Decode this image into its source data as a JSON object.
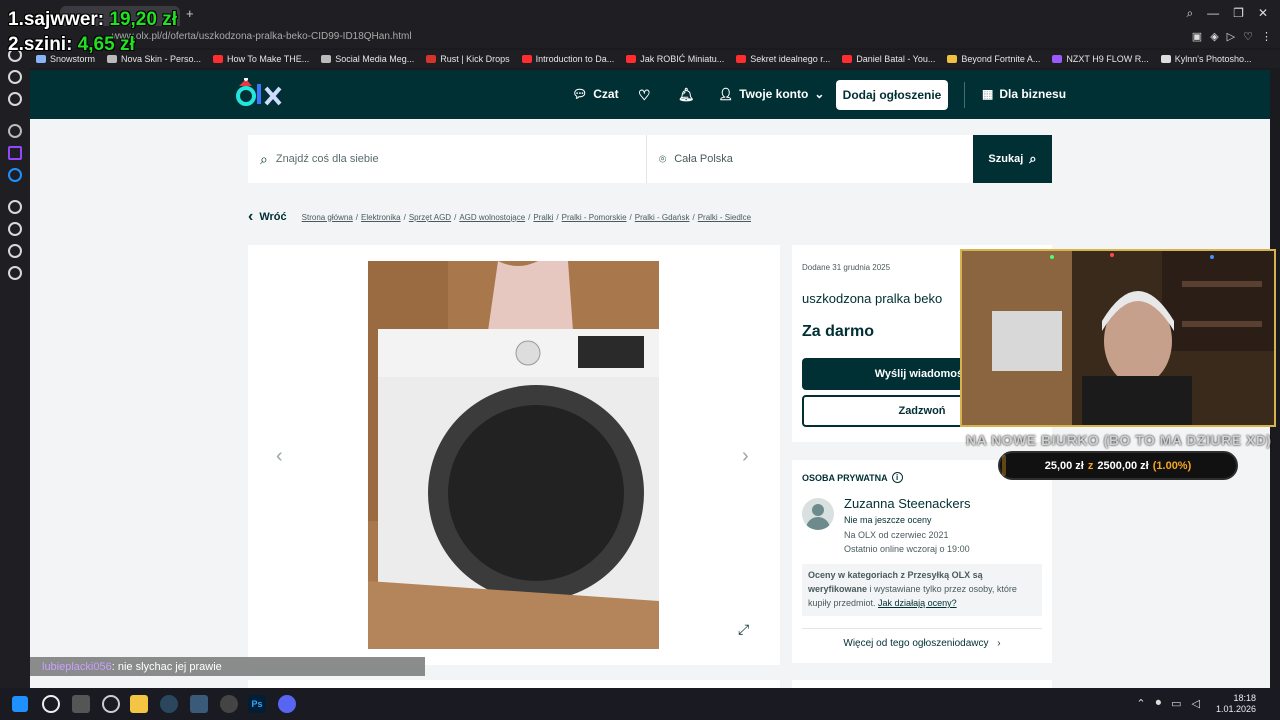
{
  "overlay": {
    "rank1_label": "1.sajwwer:",
    "rank1_amount": "19,20 zł",
    "rank2_label": "2.szini:",
    "rank2_amount": "4,65 zł"
  },
  "browser": {
    "url": "www.olx.pl/d/oferta/uszkodzona-pralka-beko-CID99-ID18QHan.html",
    "bookmarks": [
      {
        "label": "Snowstorm",
        "color": "#8ab4f8"
      },
      {
        "label": "Nova Skin - Perso...",
        "color": "#bbbbbb"
      },
      {
        "label": "How To Make THE...",
        "color": "#ff2d2d"
      },
      {
        "label": "Social Media Meg...",
        "color": "#bbbbbb"
      },
      {
        "label": "Rust | Kick Drops",
        "color": "#d4342c"
      },
      {
        "label": "Introduction to Da...",
        "color": "#ff2d2d"
      },
      {
        "label": "Jak ROBIĆ Miniatu...",
        "color": "#ff2d2d"
      },
      {
        "label": "Sekret idealnego r...",
        "color": "#ff2d2d"
      },
      {
        "label": "Daniel Batal - You...",
        "color": "#ff2d2d"
      },
      {
        "label": "Beyond Fortnite A...",
        "color": "#f0c040"
      },
      {
        "label": "NZXT H9 FLOW R...",
        "color": "#9b59ff"
      },
      {
        "label": "Kylnn's Photosho...",
        "color": "#dddddd"
      }
    ]
  },
  "olx": {
    "nav": {
      "chat": "Czat",
      "account": "Twoje konto",
      "add_listing": "Dodaj ogłoszenie",
      "business": "Dla biznesu"
    },
    "search": {
      "query_placeholder": "Znajdź coś dla siebie",
      "location": "Cała Polska",
      "button": "Szukaj"
    },
    "breadcrumb": {
      "back": "Wróć",
      "items": [
        "Strona główna",
        "Elektronika",
        "Sprzęt AGD",
        "AGD wolnostojące",
        "Pralki",
        "Pralki - Pomorskie",
        "Pralki - Gdańsk",
        "Pralki - Siedlce"
      ]
    },
    "listing": {
      "date": "Dodane 31 grudnia 2025",
      "title": "uszkodzona pralka beko",
      "price": "Za darmo",
      "message_button": "Wyślij wiadomość",
      "call_button": "Zadzwoń"
    },
    "seller": {
      "type": "OSOBA PRYWATNA",
      "name": "Zuzanna Steenackers",
      "rating": "Nie ma jeszcze oceny",
      "since": "Na OLX od czerwiec 2021",
      "last_online": "Ostatnio online wczoraj o 19:00",
      "info_strong1": "Oceny w kategoriach z Przesyłką OLX są",
      "info_strong2": "weryfikowane",
      "info_text": "i wystawiane tylko przez osoby, które kupiły przedmiot.",
      "info_link": "Jak działają oceny?",
      "more_link": "Więcej od tego ogłoszeniodawcy"
    }
  },
  "stream": {
    "cam_title": "NA NOWE BIURKO (BO TO MA DZIURE XD)",
    "goal_current": "25,00 zł",
    "goal_sep": "z",
    "goal_target": "2500,00 zł",
    "goal_pct": "(1.00%)",
    "goal_progress": 0.01,
    "chat_user": "lubieplacki056",
    "chat_message": ": nie slychac jej prawie"
  },
  "taskbar": {
    "time": "18:18",
    "date": "1.01.2026"
  },
  "colors": {
    "olx_dark": "#002f34",
    "overlay_green": "#22e022",
    "goal_orange": "#f5a623"
  }
}
